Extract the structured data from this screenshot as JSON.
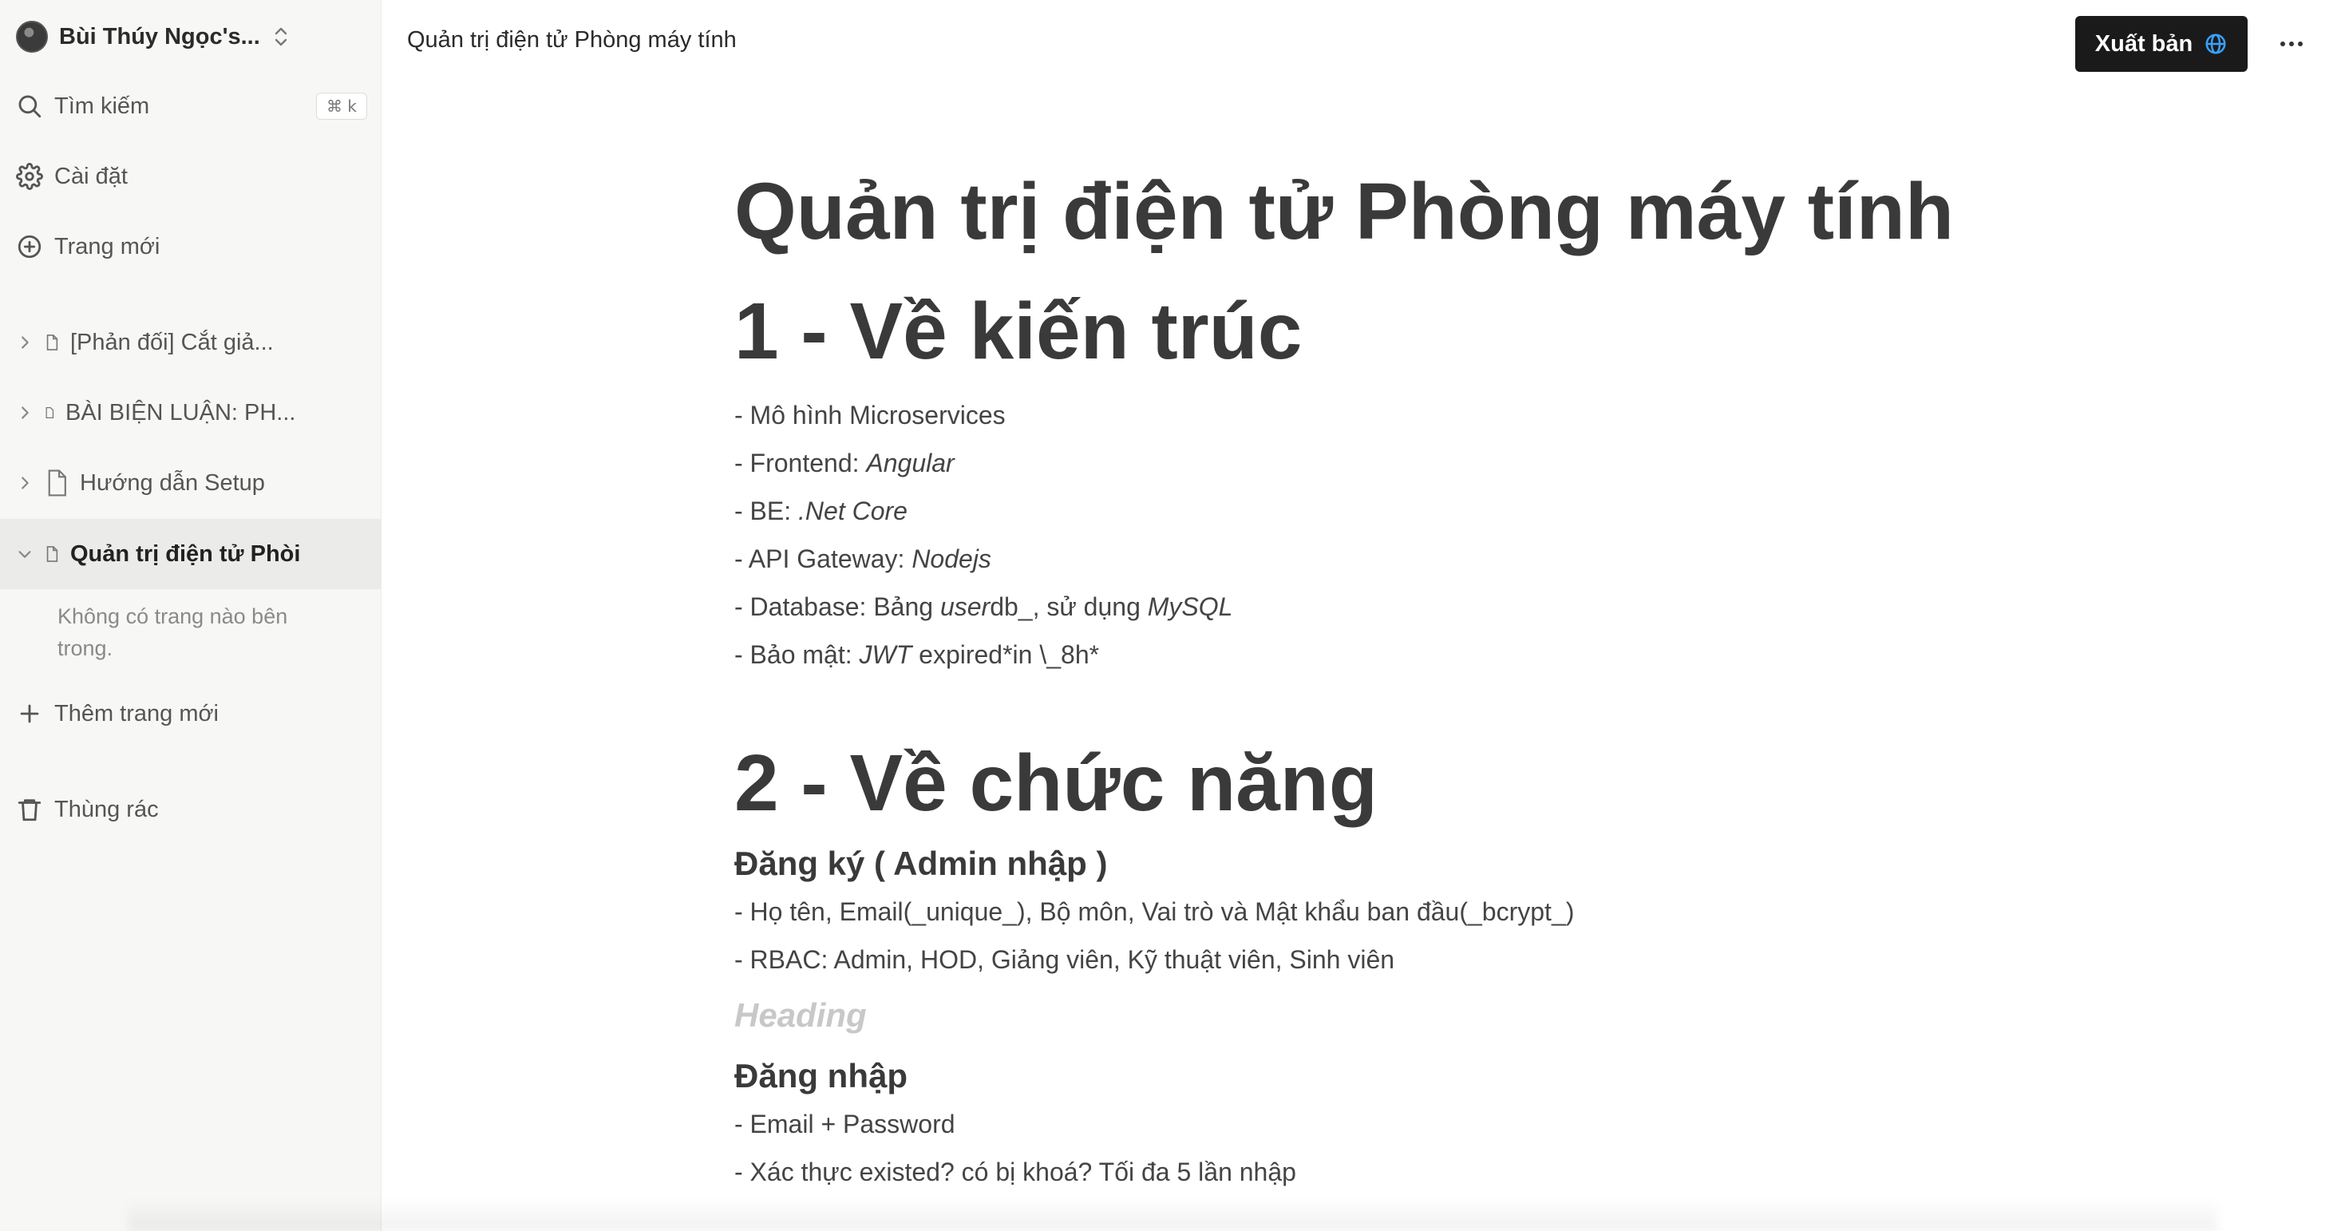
{
  "sidebar": {
    "workspace_name": "Bùi Thúy Ngọc's...",
    "search_label": "Tìm kiếm",
    "search_shortcut": "⌘ k",
    "settings_label": "Cài đặt",
    "new_page_label": "Trang mới",
    "pages": [
      {
        "label": "[Phản đối] Cắt giả..."
      },
      {
        "label": "BÀI BIỆN LUẬN: PH..."
      },
      {
        "label": "Hướng dẫn Setup"
      },
      {
        "label": "Quản trị điện tử Phòi"
      }
    ],
    "empty_note": "Không có trang nào bên trong.",
    "add_page_label": "Thêm trang mới",
    "trash_label": "Thùng rác"
  },
  "topbar": {
    "title": "Quản trị điện tử Phòng máy tính",
    "publish_label": "Xuất bản"
  },
  "document": {
    "title": "Quản trị điện tử Phòng máy tính",
    "section1_heading": "1 - Về kiến trúc",
    "s1": {
      "l1": "- Mô hình Microservices",
      "l2_prefix": "- Frontend: ",
      "l2_em": "Angular",
      "l3_prefix": "- BE: ",
      "l3_em": ".Net Core",
      "l4_prefix": "- API Gateway: ",
      "l4_em": "Nodejs",
      "l5_prefix": "- Database: Bảng ",
      "l5_em1": "user",
      "l5_mid": "db_, sử dụng ",
      "l5_em2": "MySQL",
      "l6_prefix": "- Bảo mật: ",
      "l6_em": "JWT",
      "l6_suffix": " expired*in \\_8h*"
    },
    "section2_heading": "2 - Về chức năng",
    "sub1_heading": "Đăng ký ( Admin nhập )",
    "sub1_lines": [
      "- Họ tên, Email(_unique_), Bộ môn, Vai trò và Mật khẩu ban đầu(_bcrypt_)",
      "- RBAC: Admin, HOD, Giảng viên, Kỹ thuật viên, Sinh viên"
    ],
    "placeholder_heading": "Heading",
    "sub2_heading": "Đăng nhập",
    "sub2_lines": [
      "- Email + Password",
      "- Xác thực existed? có bị khoá? Tối đa 5 lần nhập"
    ]
  }
}
